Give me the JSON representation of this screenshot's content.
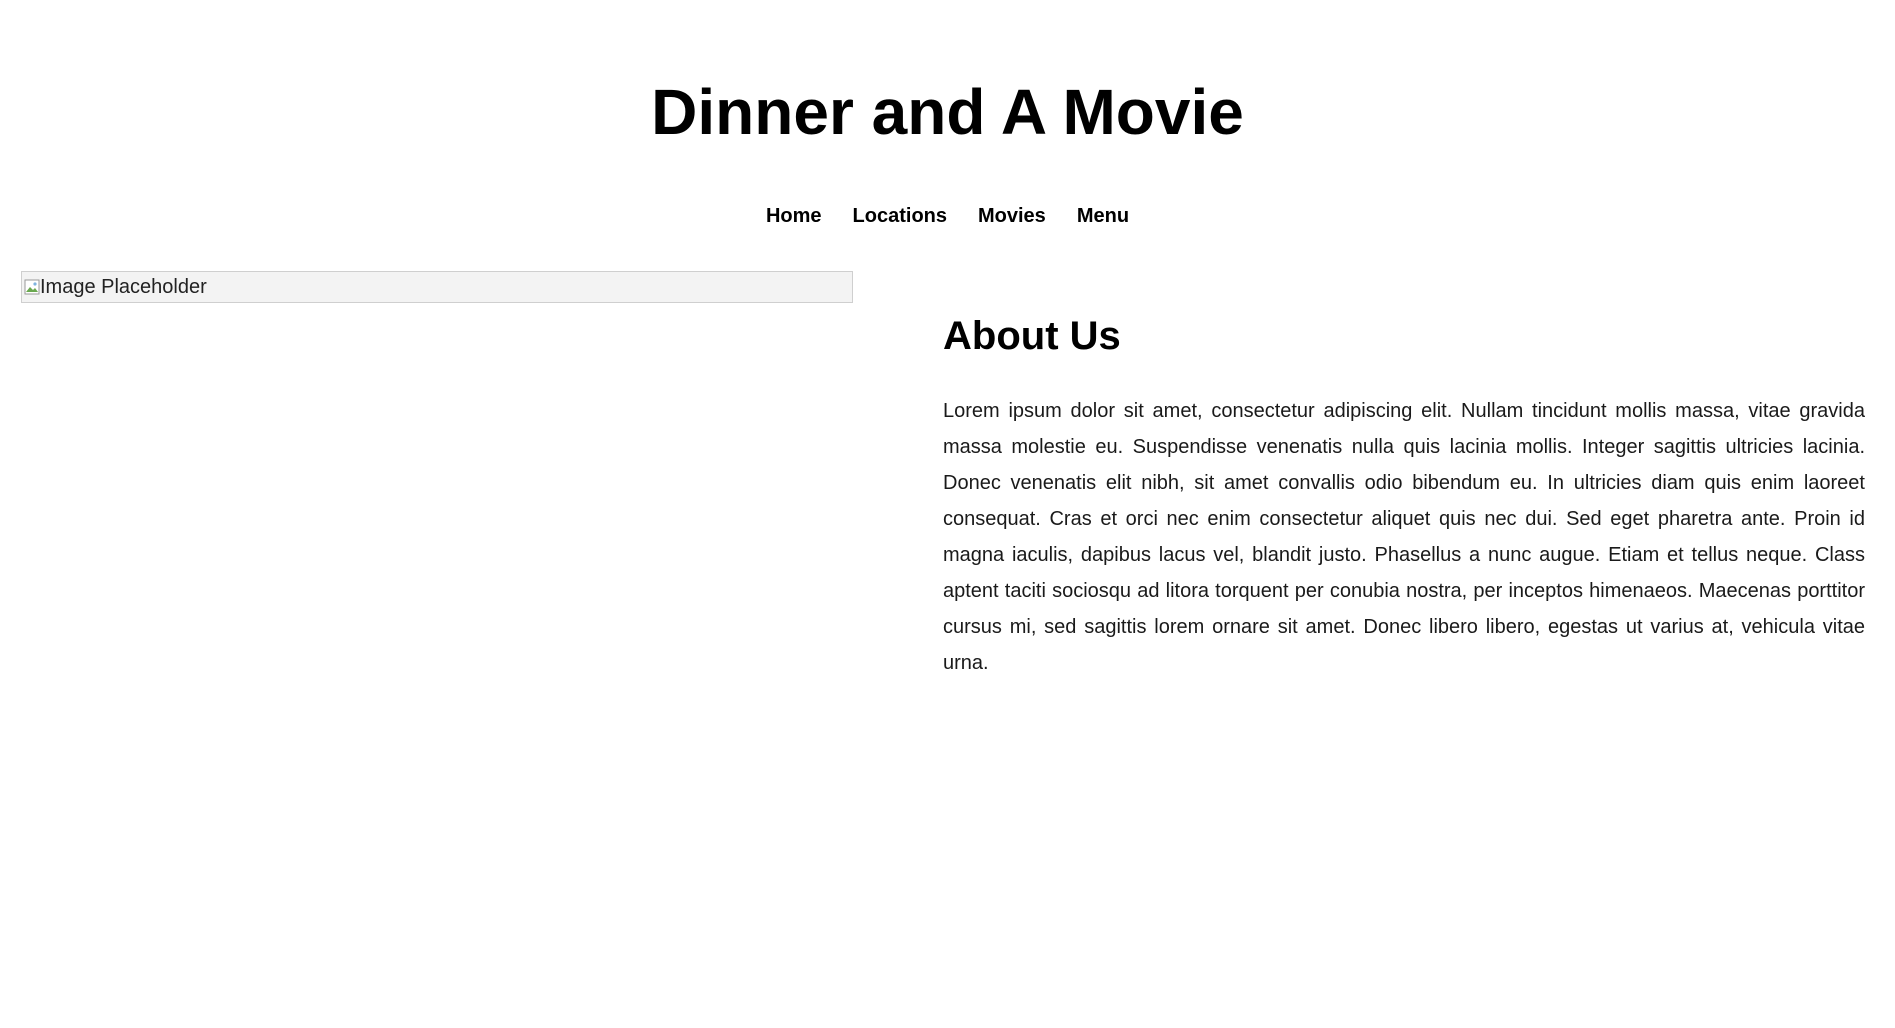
{
  "header": {
    "title": "Dinner and A Movie"
  },
  "nav": {
    "items": [
      {
        "label": "Home"
      },
      {
        "label": "Locations"
      },
      {
        "label": "Movies"
      },
      {
        "label": "Menu"
      }
    ]
  },
  "hero_image": {
    "alt": "Image Placeholder",
    "icon": "broken-image-icon"
  },
  "about": {
    "title": "About Us",
    "body": "Lorem ipsum dolor sit amet, consectetur adipiscing elit. Nullam tincidunt mollis massa, vitae gravida massa molestie eu. Suspendisse venenatis nulla quis lacinia mollis. Integer sagittis ultricies lacinia. Donec venenatis elit nibh, sit amet convallis odio bibendum eu. In ultricies diam quis enim laoreet consequat. Cras et orci nec enim consectetur aliquet quis nec dui. Sed eget pharetra ante. Proin id magna iaculis, dapibus lacus vel, blandit justo. Phasellus a nunc augue. Etiam et tellus neque. Class aptent taciti sociosqu ad litora torquent per conubia nostra, per inceptos himenaeos. Maecenas porttitor cursus mi, sed sagittis lorem ornare sit amet. Donec libero libero, egestas ut varius at, vehicula vitae urna."
  }
}
